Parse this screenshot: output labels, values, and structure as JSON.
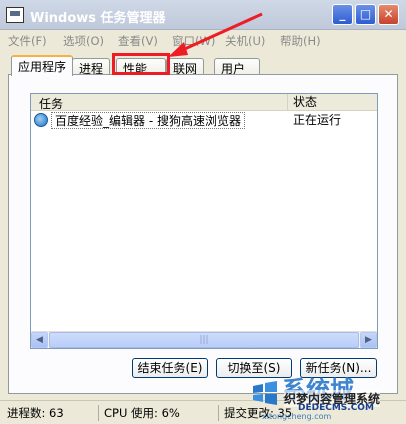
{
  "window": {
    "title": "Windows 任务管理器",
    "btn_min": "_",
    "btn_max": "□",
    "btn_close": "✕"
  },
  "menu": [
    {
      "label": "文件(F)"
    },
    {
      "label": "选项(O)"
    },
    {
      "label": "查看(V)"
    },
    {
      "label": "窗口(W)"
    },
    {
      "label": "关机(U)"
    },
    {
      "label": "帮助(H)"
    }
  ],
  "tabs": [
    {
      "label": "应用程序",
      "active": true
    },
    {
      "label": "进程"
    },
    {
      "label": "性能"
    },
    {
      "label": "联网"
    },
    {
      "label": "用户"
    }
  ],
  "task_list": {
    "columns": {
      "task": "任务",
      "status": "状态"
    },
    "rows": [
      {
        "name": "百度经验_编辑器 - 搜狗高速浏览器",
        "status": "正在运行",
        "icon": "browser-icon"
      }
    ],
    "scroll_left": "◀",
    "scroll_right": "▶",
    "scroll_grip": "|||"
  },
  "buttons": {
    "end_task": "结束任务(E)",
    "switch_to": "切换至(S)",
    "new_task": "新任务(N)..."
  },
  "statusbar": {
    "processes": "进程数: 63",
    "cpu": "CPU 使用: 6%",
    "commit": "提交更改: 35"
  },
  "annotation": {
    "color": "#ee1c24"
  },
  "watermark": {
    "big": "系统城",
    "line1": "织梦内容管理系统",
    "line2": "DEDECMS.COM",
    "line3": "xitongcheng.com"
  }
}
